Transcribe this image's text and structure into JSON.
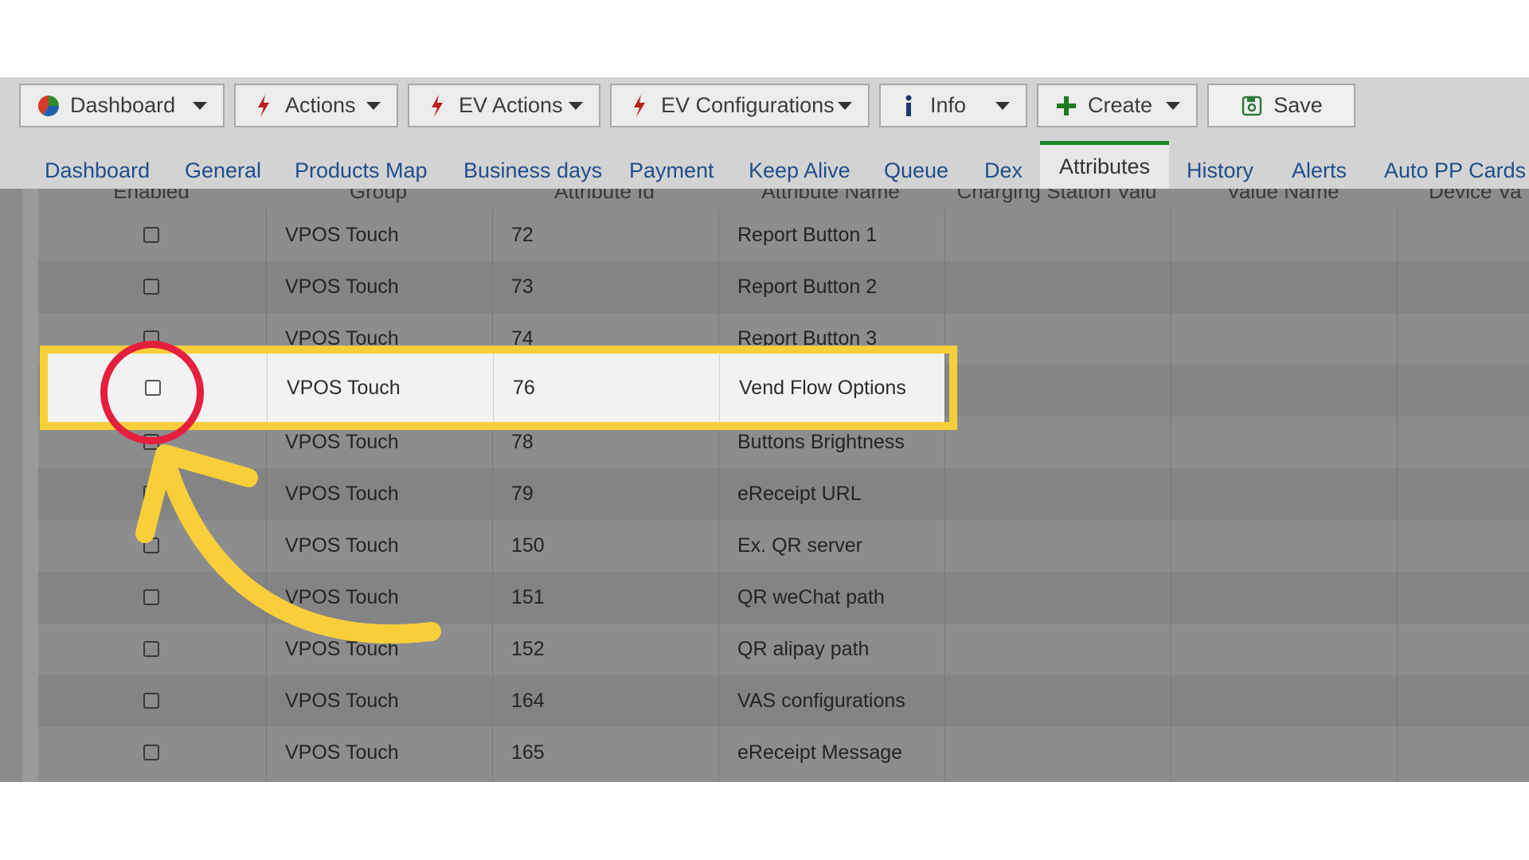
{
  "toolbar": {
    "buttons": [
      {
        "label": "Dashboard",
        "icon": "pie-chart-icon"
      },
      {
        "label": "Actions",
        "icon": "lightning-icon"
      },
      {
        "label": "EV Actions",
        "icon": "lightning-icon"
      },
      {
        "label": "EV Configurations",
        "icon": "lightning-icon"
      },
      {
        "label": "Info",
        "icon": "info-icon"
      },
      {
        "label": "Create",
        "icon": "plus-icon"
      },
      {
        "label": "Save",
        "icon": "save-icon"
      }
    ]
  },
  "tabs": [
    "Dashboard",
    "General",
    "Products Map",
    "Business days",
    "Payment",
    "Keep Alive",
    "Queue",
    "Dex",
    "Attributes",
    "History",
    "Alerts",
    "Auto PP Cards"
  ],
  "active_tab": "Attributes",
  "table": {
    "columns": [
      "Enabled",
      "Group",
      "Attribute Id",
      "Attribute Name",
      "Charging Station Valu",
      "Value Name",
      "Device Va"
    ],
    "rows": [
      {
        "group": "VPOS Touch",
        "id": "72",
        "name": "Report Button 1"
      },
      {
        "group": "VPOS Touch",
        "id": "73",
        "name": "Report Button 2"
      },
      {
        "group": "VPOS Touch",
        "id": "74",
        "name": "Report Button 3"
      },
      {
        "group": "VPOS Touch",
        "id": "76",
        "name": "Vend Flow Options"
      },
      {
        "group": "VPOS Touch",
        "id": "78",
        "name": "Buttons Brightness"
      },
      {
        "group": "VPOS Touch",
        "id": "79",
        "name": "eReceipt URL"
      },
      {
        "group": "VPOS Touch",
        "id": "150",
        "name": "Ex. QR server"
      },
      {
        "group": "VPOS Touch",
        "id": "151",
        "name": "QR weChat path"
      },
      {
        "group": "VPOS Touch",
        "id": "152",
        "name": "QR alipay path"
      },
      {
        "group": "VPOS Touch",
        "id": "164",
        "name": "VAS configurations"
      },
      {
        "group": "VPOS Touch",
        "id": "165",
        "name": "eReceipt Message"
      }
    ]
  },
  "colors": {
    "highlight_box": "#f8cf3a",
    "circle": "#e51f3e",
    "arrow": "#f8cf3a",
    "active_tab_border": "#1b8a2a",
    "tab_text": "#1f4e8c"
  }
}
